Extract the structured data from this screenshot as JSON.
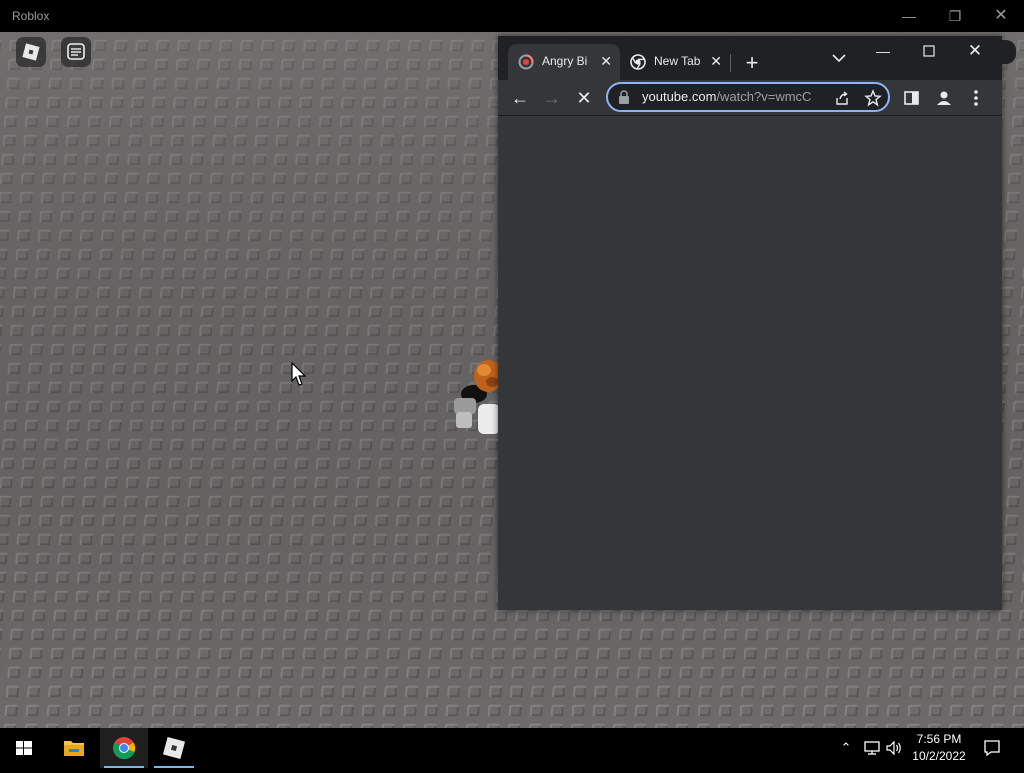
{
  "roblox": {
    "title": "Roblox",
    "controls": {
      "minimize": "—",
      "restore": "❐",
      "close": "✕"
    }
  },
  "chrome": {
    "tabs": [
      {
        "title": "Angry Bi",
        "close": "✕",
        "icon": "youtube-loading-icon"
      },
      {
        "title": "New Tab",
        "close": "✕",
        "icon": "chrome-icon"
      }
    ],
    "new_tab": "+",
    "window_controls": {
      "minimize": "—",
      "close": "✕"
    },
    "toolbar": {
      "back": "←",
      "forward": "→",
      "stop": "✕"
    },
    "omnibox": {
      "url_host": "youtube.com",
      "url_path": "/watch?v=wmcC"
    }
  },
  "taskbar": {
    "clock": {
      "time": "7:56 PM",
      "date": "10/2/2022"
    },
    "tray": {
      "chevron": "⌃"
    }
  },
  "colors": {
    "baseplate": "#6b6868",
    "chrome_frame": "#202124",
    "chrome_toolbar": "#35363a",
    "omnibox_focus": "#8ab4f8",
    "taskbar": "#000000"
  }
}
